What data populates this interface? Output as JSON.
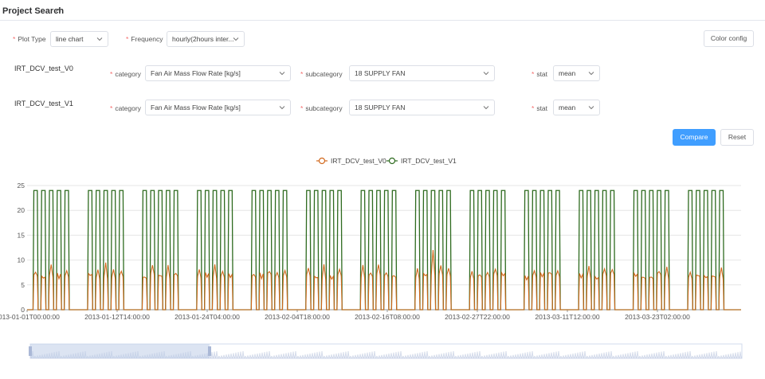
{
  "header": {
    "title": "Project Search",
    "chevron_icon": "chevron-up-icon"
  },
  "controls": {
    "plot_type": {
      "label": "Plot Type",
      "value": "line chart"
    },
    "frequency": {
      "label": "Frequency",
      "value": "hourly(2hours inter..."
    },
    "color_config_label": "Color config"
  },
  "rows": [
    {
      "name": "IRT_DCV_test_V0",
      "category_label": "category",
      "category_value": "Fan Air Mass Flow Rate [kg/s]",
      "subcategory_label": "subcategory",
      "subcategory_value": "18 SUPPLY FAN",
      "stat_label": "stat",
      "stat_value": "mean"
    },
    {
      "name": "IRT_DCV_test_V1",
      "category_label": "category",
      "category_value": "Fan Air Mass Flow Rate [kg/s]",
      "subcategory_label": "subcategory",
      "subcategory_value": "18 SUPPLY FAN",
      "stat_label": "stat",
      "stat_value": "mean"
    }
  ],
  "actions": {
    "compare_label": "Compare",
    "reset_label": "Reset"
  },
  "colors": {
    "accent": "#409eff",
    "series_v0": "#d2691e",
    "series_v1": "#2e6b1f",
    "required": "#f56c6c"
  },
  "chart_data": {
    "type": "line",
    "series": [
      {
        "name": "IRT_DCV_test_V0",
        "peak_range": [
          6,
          13
        ]
      },
      {
        "name": "IRT_DCV_test_V1",
        "peak": 24
      }
    ],
    "ylim": [
      0,
      25
    ],
    "yticks": [
      0,
      5,
      10,
      15,
      20,
      25
    ],
    "xticks": [
      "2013-01-01T00:00:00",
      "2013-01-12T14:00:00",
      "2013-01-24T04:00:00",
      "2013-02-04T18:00:00",
      "2013-02-16T08:00:00",
      "2013-02-27T22:00:00",
      "2013-03-11T12:00:00",
      "2013-03-23T02:00:00"
    ],
    "legend_position": "top-center",
    "grid": true
  }
}
